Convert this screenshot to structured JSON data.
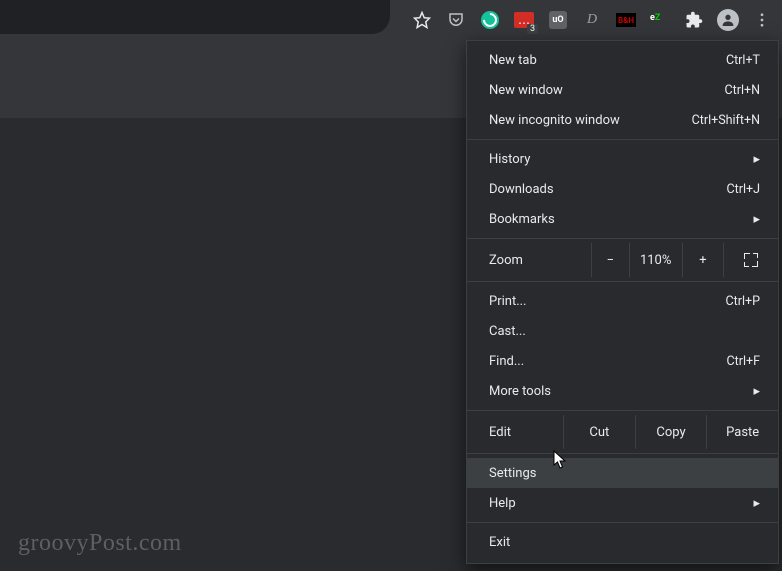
{
  "toolbar": {
    "icons": {
      "star": "star-icon",
      "pocket": "pocket-icon",
      "grammarly": "grammarly-icon",
      "lastpass": "lastpass-icon",
      "lastpass_badge": "3",
      "ublock": "uO",
      "d": "D",
      "bh": "B&H",
      "ez_e": "e",
      "ez_z": "Z",
      "extensions": "extensions-icon",
      "profile": "profile-icon",
      "menu": "menu-dots-icon"
    }
  },
  "menu": {
    "new_tab": {
      "label": "New tab",
      "shortcut": "Ctrl+T"
    },
    "new_window": {
      "label": "New window",
      "shortcut": "Ctrl+N"
    },
    "new_incognito": {
      "label": "New incognito window",
      "shortcut": "Ctrl+Shift+N"
    },
    "history": {
      "label": "History"
    },
    "downloads": {
      "label": "Downloads",
      "shortcut": "Ctrl+J"
    },
    "bookmarks": {
      "label": "Bookmarks"
    },
    "zoom": {
      "label": "Zoom",
      "minus": "−",
      "value": "110%",
      "plus": "+"
    },
    "print": {
      "label": "Print...",
      "shortcut": "Ctrl+P"
    },
    "cast": {
      "label": "Cast..."
    },
    "find": {
      "label": "Find...",
      "shortcut": "Ctrl+F"
    },
    "more_tools": {
      "label": "More tools"
    },
    "edit": {
      "label": "Edit",
      "cut": "Cut",
      "copy": "Copy",
      "paste": "Paste"
    },
    "settings": {
      "label": "Settings"
    },
    "help": {
      "label": "Help"
    },
    "exit": {
      "label": "Exit"
    }
  },
  "watermark": "groovyPost.com"
}
